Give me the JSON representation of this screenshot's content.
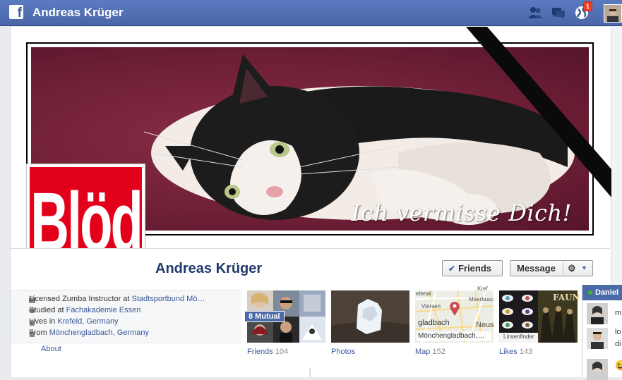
{
  "topbar": {
    "title": "Andreas Krüger",
    "notification_count": "1",
    "icons": [
      "facebook-logo-icon",
      "friend-requests-icon",
      "messages-icon",
      "notifications-globe-icon"
    ]
  },
  "cover": {
    "caption": "Ich vermisse Dich!"
  },
  "profile": {
    "name": "Andreas Krüger",
    "profile_picture_text": "Blöd"
  },
  "actions": {
    "friends_label": "Friends",
    "message_label": "Message"
  },
  "about": {
    "rows": [
      {
        "prefix": "Licensed Zumba Instructor at ",
        "link": "Stadtsportbund Mö…",
        "icon": "briefcase-icon"
      },
      {
        "prefix": "Studied at ",
        "link": "Fachakademie Essen",
        "icon": "graduation-cap-icon"
      },
      {
        "prefix": "Lives in ",
        "link": "Krefeld, Germany",
        "icon": "house-icon"
      },
      {
        "prefix": "From ",
        "link": "Mönchengladbach, Germany",
        "icon": "house-icon"
      }
    ],
    "about_link": "About"
  },
  "tiles": {
    "friends": {
      "label": "Friends",
      "count": "104",
      "mutual": "8 Mutual"
    },
    "photos": {
      "label": "Photos"
    },
    "map": {
      "label": "Map",
      "count": "152",
      "city_label": "Mönchengladbach,…",
      "viersen": "Viersen",
      "meerbusch": "Meerbusc",
      "gladbach": "gladbach",
      "neus": "Neus",
      "gettal": "ettetal",
      "kref": "Kref"
    },
    "likes": {
      "label": "Likes",
      "count": "143",
      "linsenfinder": "Linsenfinder",
      "faun": "FAUN"
    }
  },
  "chat": {
    "contact_name": "Daniel",
    "snippets": [
      "m",
      "lo",
      "di",
      "😆"
    ]
  }
}
